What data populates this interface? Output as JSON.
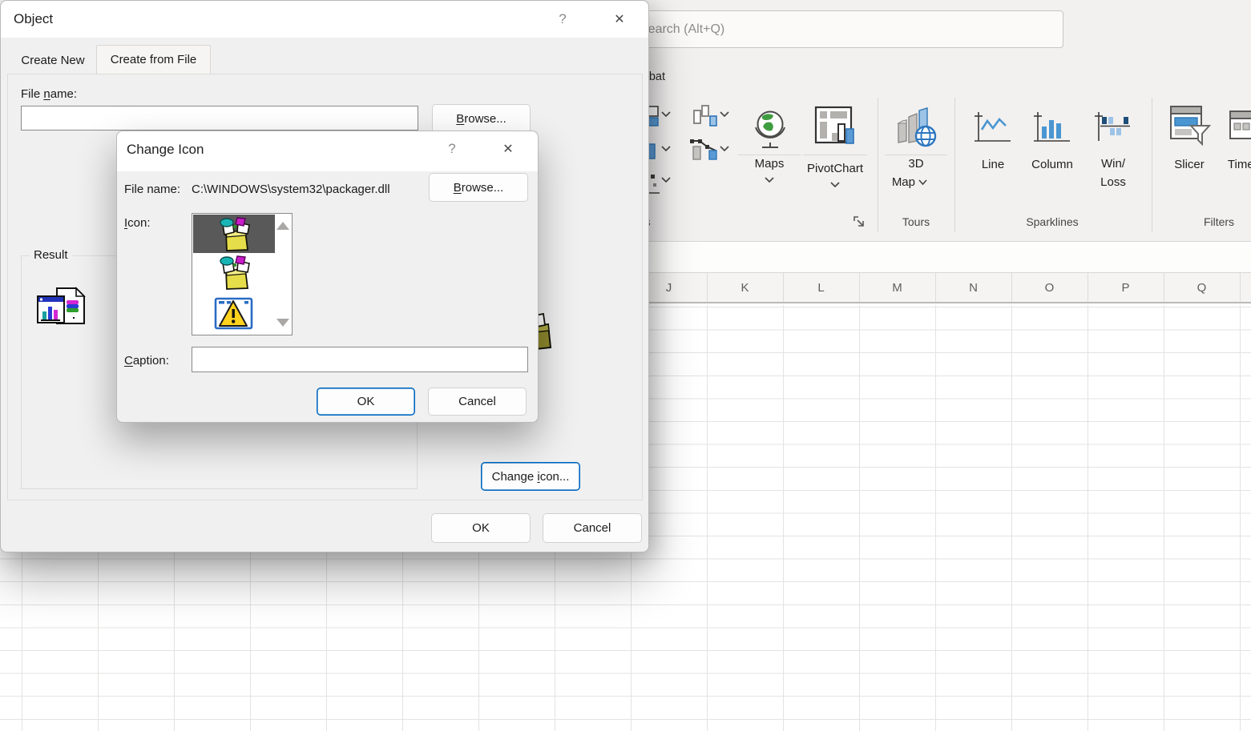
{
  "glyphs": {
    "help": "?",
    "close": "✕"
  },
  "excel": {
    "search_placeholder": "Search (Alt+Q)",
    "acrobat_tab": "Acrobat",
    "column_headers": [
      "J",
      "K",
      "L",
      "M",
      "N",
      "O",
      "P",
      "Q"
    ],
    "groups": {
      "charts_label": "Charts",
      "tours_label": "Tours",
      "sparklines_label": "Sparklines",
      "filters_label": "Filters"
    },
    "buttons": {
      "maps": "Maps",
      "pivotchart": "PivotChart",
      "map3d_line1": "3D",
      "map3d_line2": "Map",
      "line": "Line",
      "column": "Column",
      "winloss_line1": "Win/",
      "winloss_line2": "Loss",
      "slicer": "Slicer",
      "timeline": "Timeline"
    }
  },
  "object_dialog": {
    "title": "Object",
    "tabs": {
      "create_new": "Create New",
      "create_from_file": "Create from File"
    },
    "file_name_label": {
      "pre": "File ",
      "key": "n",
      "post": "ame:"
    },
    "file_name_value": "",
    "browse": {
      "key": "B",
      "post": "rowse..."
    },
    "result_label": "Result",
    "change_icon": {
      "pre": "Change ",
      "key": "i",
      "post": "con..."
    },
    "ok_label": "OK",
    "cancel_label": "Cancel"
  },
  "change_icon_dialog": {
    "title": "Change Icon",
    "file_name_label": "File name:",
    "file_path": "C:\\WINDOWS\\system32\\packager.dll",
    "browse": {
      "key": "B",
      "post": "rowse..."
    },
    "icon_label": {
      "key": "I",
      "post": "con:"
    },
    "caption_label": {
      "key": "C",
      "post": "aption:"
    },
    "caption_value": "",
    "ok_label": "OK",
    "cancel_label": "Cancel"
  }
}
